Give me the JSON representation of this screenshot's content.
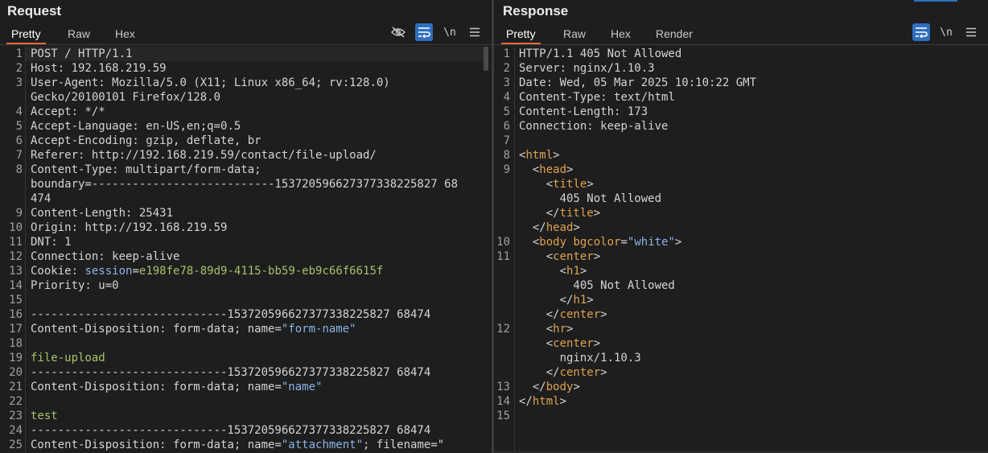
{
  "request": {
    "title": "Request",
    "tabs": [
      {
        "label": "Pretty",
        "active": true
      },
      {
        "label": "Raw",
        "active": false
      },
      {
        "label": "Hex",
        "active": false
      }
    ],
    "tools": {
      "hide_icon": "eye-slash-icon",
      "wrap_icon": "word-wrap-icon",
      "newline_label": "\\n",
      "menu_icon": "hamburger-menu-icon"
    },
    "lines": [
      {
        "n": "1",
        "parts": [
          [
            "k",
            "POST / HTTP/1.1"
          ]
        ]
      },
      {
        "n": "2",
        "parts": [
          [
            "k",
            "Host: "
          ],
          [
            "v",
            "192.168.219.59"
          ]
        ]
      },
      {
        "n": "3",
        "parts": [
          [
            "k",
            "User-Agent: "
          ],
          [
            "v",
            "Mozilla/5.0 (X11; Linux x86_64; rv:128.0)"
          ]
        ]
      },
      {
        "n": "",
        "parts": [
          [
            "v",
            "Gecko/20100101 Firefox/128.0"
          ]
        ]
      },
      {
        "n": "4",
        "parts": [
          [
            "k",
            "Accept: "
          ],
          [
            "v",
            "*/*"
          ]
        ]
      },
      {
        "n": "5",
        "parts": [
          [
            "k",
            "Accept-Language: "
          ],
          [
            "v",
            "en-US,en;q=0.5"
          ]
        ]
      },
      {
        "n": "6",
        "parts": [
          [
            "k",
            "Accept-Encoding: "
          ],
          [
            "v",
            "gzip, deflate, br"
          ]
        ]
      },
      {
        "n": "7",
        "parts": [
          [
            "k",
            "Referer: "
          ],
          [
            "v",
            "http://192.168.219.59/contact/file-upload/"
          ]
        ]
      },
      {
        "n": "8",
        "parts": [
          [
            "k",
            "Content-Type: "
          ],
          [
            "v",
            "multipart/form-data;"
          ]
        ]
      },
      {
        "n": "",
        "parts": [
          [
            "v",
            "boundary=---------------------------153720596627377338225827 68"
          ]
        ]
      },
      {
        "n": "",
        "parts": [
          [
            "v",
            "474"
          ]
        ]
      },
      {
        "n": "9",
        "parts": [
          [
            "k",
            "Content-Length: "
          ],
          [
            "v",
            "25431"
          ]
        ]
      },
      {
        "n": "10",
        "parts": [
          [
            "k",
            "Origin: "
          ],
          [
            "v",
            "http://192.168.219.59"
          ]
        ]
      },
      {
        "n": "11",
        "parts": [
          [
            "k",
            "DNT: "
          ],
          [
            "v",
            "1"
          ]
        ]
      },
      {
        "n": "12",
        "parts": [
          [
            "k",
            "Connection: "
          ],
          [
            "v",
            "keep-alive"
          ]
        ]
      },
      {
        "n": "13",
        "parts": [
          [
            "k",
            "Cookie: "
          ],
          [
            "sess",
            "session"
          ],
          [
            "k",
            "="
          ],
          [
            "cookieval",
            "e198fe78-89d9-4115-bb59-eb9c66f6615f"
          ]
        ]
      },
      {
        "n": "14",
        "parts": [
          [
            "k",
            "Priority: "
          ],
          [
            "v",
            "u=0"
          ]
        ]
      },
      {
        "n": "15",
        "parts": []
      },
      {
        "n": "16",
        "parts": [
          [
            "v",
            "-----------------------------153720596627377338225827 68474"
          ]
        ]
      },
      {
        "n": "17",
        "parts": [
          [
            "k",
            "Content-Disposition: "
          ],
          [
            "v",
            "form-data; name="
          ],
          [
            "str",
            "\"form-name\""
          ]
        ]
      },
      {
        "n": "18",
        "parts": []
      },
      {
        "n": "19",
        "parts": [
          [
            "green",
            "file-upload"
          ]
        ]
      },
      {
        "n": "20",
        "parts": [
          [
            "v",
            "-----------------------------153720596627377338225827 68474"
          ]
        ]
      },
      {
        "n": "21",
        "parts": [
          [
            "k",
            "Content-Disposition: "
          ],
          [
            "v",
            "form-data; name="
          ],
          [
            "str",
            "\"name\""
          ]
        ]
      },
      {
        "n": "22",
        "parts": []
      },
      {
        "n": "23",
        "parts": [
          [
            "green",
            "test"
          ]
        ]
      },
      {
        "n": "24",
        "parts": [
          [
            "v",
            "-----------------------------153720596627377338225827 68474"
          ]
        ]
      },
      {
        "n": "25",
        "parts": [
          [
            "k",
            "Content-Disposition: "
          ],
          [
            "v",
            "form-data; name="
          ],
          [
            "str",
            "\"attachment\""
          ],
          [
            "v",
            "; filename=\""
          ]
        ]
      }
    ]
  },
  "response": {
    "title": "Response",
    "tabs": [
      {
        "label": "Pretty",
        "active": true
      },
      {
        "label": "Raw",
        "active": false
      },
      {
        "label": "Hex",
        "active": false
      },
      {
        "label": "Render",
        "active": false
      }
    ],
    "tools": {
      "wrap_icon": "word-wrap-icon",
      "newline_label": "\\n",
      "menu_icon": "hamburger-menu-icon"
    },
    "lines": [
      {
        "n": "1",
        "parts": [
          [
            "k",
            "HTTP/1.1 405 Not Allowed"
          ]
        ]
      },
      {
        "n": "2",
        "parts": [
          [
            "k",
            "Server: "
          ],
          [
            "v",
            "nginx/1.10.3"
          ]
        ]
      },
      {
        "n": "3",
        "parts": [
          [
            "k",
            "Date: "
          ],
          [
            "v",
            "Wed, 05 Mar 2025 10:10:22 GMT"
          ]
        ]
      },
      {
        "n": "4",
        "parts": [
          [
            "k",
            "Content-Type: "
          ],
          [
            "v",
            "text/html"
          ]
        ]
      },
      {
        "n": "5",
        "parts": [
          [
            "k",
            "Content-Length: "
          ],
          [
            "v",
            "173"
          ]
        ]
      },
      {
        "n": "6",
        "parts": [
          [
            "k",
            "Connection: "
          ],
          [
            "v",
            "keep-alive"
          ]
        ]
      },
      {
        "n": "7",
        "parts": []
      },
      {
        "n": "8",
        "parts": [
          [
            "tag",
            "<"
          ],
          [
            "tname",
            "html"
          ],
          [
            "tag",
            ">"
          ]
        ]
      },
      {
        "n": "9",
        "parts": [
          [
            "tag",
            "  <"
          ],
          [
            "tname",
            "head"
          ],
          [
            "tag",
            ">"
          ]
        ]
      },
      {
        "n": "",
        "parts": [
          [
            "tag",
            "    <"
          ],
          [
            "tname",
            "title"
          ],
          [
            "tag",
            ">"
          ]
        ]
      },
      {
        "n": "",
        "parts": [
          [
            "v",
            "      405 Not Allowed"
          ]
        ]
      },
      {
        "n": "",
        "parts": [
          [
            "tag",
            "    </"
          ],
          [
            "tname",
            "title"
          ],
          [
            "tag",
            ">"
          ]
        ]
      },
      {
        "n": "",
        "parts": [
          [
            "tag",
            "  </"
          ],
          [
            "tname",
            "head"
          ],
          [
            "tag",
            ">"
          ]
        ]
      },
      {
        "n": "10",
        "parts": [
          [
            "tag",
            "  <"
          ],
          [
            "tname",
            "body "
          ],
          [
            "aname",
            "bgcolor"
          ],
          [
            "tag",
            "="
          ],
          [
            "aval",
            "\"white\""
          ],
          [
            "tag",
            ">"
          ]
        ]
      },
      {
        "n": "11",
        "parts": [
          [
            "tag",
            "    <"
          ],
          [
            "tname",
            "center"
          ],
          [
            "tag",
            ">"
          ]
        ]
      },
      {
        "n": "",
        "parts": [
          [
            "tag",
            "      <"
          ],
          [
            "tname",
            "h1"
          ],
          [
            "tag",
            ">"
          ]
        ]
      },
      {
        "n": "",
        "parts": [
          [
            "v",
            "        405 Not Allowed"
          ]
        ]
      },
      {
        "n": "",
        "parts": [
          [
            "tag",
            "      </"
          ],
          [
            "tname",
            "h1"
          ],
          [
            "tag",
            ">"
          ]
        ]
      },
      {
        "n": "",
        "parts": [
          [
            "tag",
            "    </"
          ],
          [
            "tname",
            "center"
          ],
          [
            "tag",
            ">"
          ]
        ]
      },
      {
        "n": "12",
        "parts": [
          [
            "tag",
            "    <"
          ],
          [
            "tname",
            "hr"
          ],
          [
            "tag",
            ">"
          ]
        ]
      },
      {
        "n": "",
        "parts": [
          [
            "tag",
            "    <"
          ],
          [
            "tname",
            "center"
          ],
          [
            "tag",
            ">"
          ]
        ]
      },
      {
        "n": "",
        "parts": [
          [
            "v",
            "      nginx/1.10.3"
          ]
        ]
      },
      {
        "n": "",
        "parts": [
          [
            "tag",
            "    </"
          ],
          [
            "tname",
            "center"
          ],
          [
            "tag",
            ">"
          ]
        ]
      },
      {
        "n": "13",
        "parts": [
          [
            "tag",
            "  </"
          ],
          [
            "tname",
            "body"
          ],
          [
            "tag",
            ">"
          ]
        ]
      },
      {
        "n": "14",
        "parts": [
          [
            "tag",
            "</"
          ],
          [
            "tname",
            "html"
          ],
          [
            "tag",
            ">"
          ]
        ]
      },
      {
        "n": "15",
        "parts": []
      }
    ]
  }
}
